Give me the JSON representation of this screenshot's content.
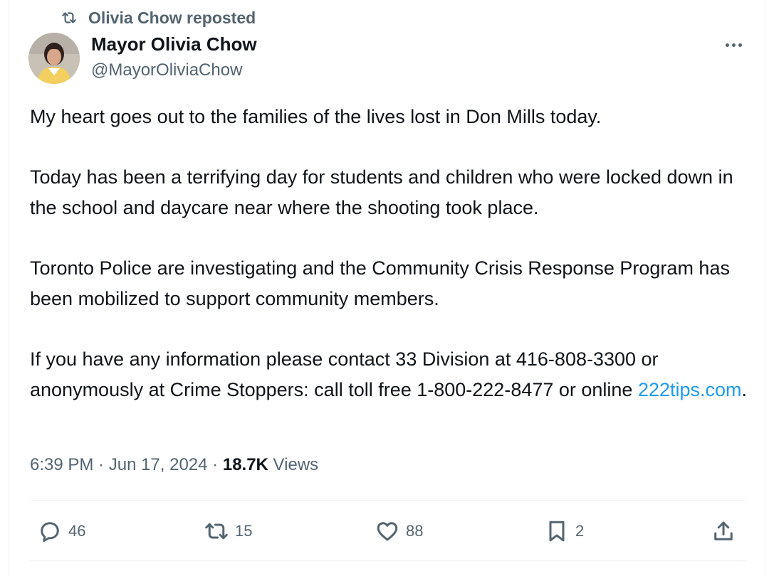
{
  "repost_banner": {
    "text": "Olivia Chow reposted",
    "icon": "repost-icon"
  },
  "author": {
    "name": "Mayor Olivia Chow",
    "handle": "@MayorOliviaChow",
    "avatar": "profile-photo"
  },
  "more_menu": {
    "icon": "more-options-icon"
  },
  "tweet": {
    "paragraphs": [
      "My heart goes out to the families of the lives lost in Don Mills today.",
      "Today has been a terrifying day for students and children who were locked down in the school and daycare near where the shooting took place.",
      "Toronto Police are investigating and the Community Crisis Response Program has been mobilized to support community members."
    ],
    "last_paragraph_text": "If you have any information please contact 33 Division at 416-808-3300 or anonymously at Crime Stoppers: call toll free 1-800-222-8477 or online ",
    "link_text": "222tips.com",
    "trailing_text": "."
  },
  "meta": {
    "time": "6:39 PM",
    "separator1": " · ",
    "date": "Jun 17, 2024",
    "separator2": " · ",
    "views_count": "18.7K",
    "views_label": " Views"
  },
  "actions": {
    "reply": {
      "count": "46",
      "icon": "reply-icon"
    },
    "repost": {
      "count": "15",
      "icon": "repost-icon"
    },
    "like": {
      "count": "88",
      "icon": "heart-icon"
    },
    "bookmark": {
      "count": "2",
      "icon": "bookmark-icon"
    },
    "share": {
      "icon": "share-icon"
    }
  },
  "colors": {
    "text_primary": "#0f1419",
    "text_secondary": "#536471",
    "link": "#1d9bf0",
    "divider": "#eff3f4"
  }
}
